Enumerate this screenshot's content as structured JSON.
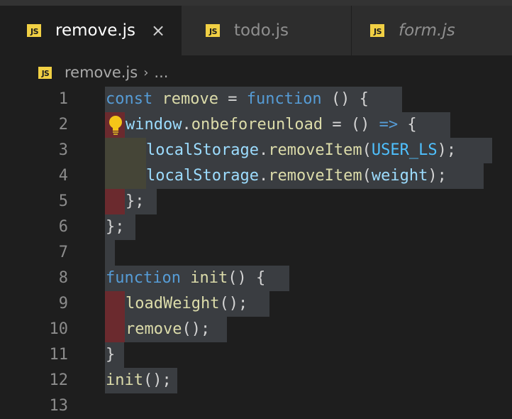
{
  "tabs": [
    {
      "label": "remove.js",
      "badge": "JS",
      "active": true,
      "italic": false,
      "close": "×"
    },
    {
      "label": "todo.js",
      "badge": "JS",
      "active": false,
      "italic": false
    },
    {
      "label": "form.js",
      "badge": "JS",
      "active": false,
      "italic": true
    }
  ],
  "breadcrumb": {
    "badge": "JS",
    "file": "remove.js",
    "separator": "›",
    "more": "..."
  },
  "colors": {
    "keyword": "#569cd6",
    "variable": "#9cdcfe",
    "function": "#dcdcaa",
    "constant": "#4fc1ff",
    "selection": "#3a3d41",
    "js_badge": "#f1d044"
  },
  "gutter": [
    "1",
    "2",
    "3",
    "4",
    "5",
    "6",
    "7",
    "8",
    "9",
    "10",
    "11",
    "12",
    "13"
  ],
  "lines": {
    "l1": {
      "kw": "const",
      "name": "remove",
      "eq": "=",
      "kw2": "function",
      "rest": "() {"
    },
    "l2": {
      "obj": "window",
      "dot": ".",
      "prop": "onbeforeunload",
      "eq": "=",
      "rest": "()",
      "arrow": "=>",
      "brace": "{"
    },
    "l3": {
      "obj": "localStorage",
      "dot": ".",
      "method": "removeItem",
      "open": "(",
      "arg": "USER_LS",
      "close": ");"
    },
    "l4": {
      "obj": "localStorage",
      "dot": ".",
      "method": "removeItem",
      "open": "(",
      "arg": "weight",
      "close": ");"
    },
    "l5": {
      "text": "};"
    },
    "l6": {
      "text": "};"
    },
    "l8": {
      "kw": "function",
      "name": "init",
      "rest": "() {"
    },
    "l9": {
      "name": "loadWeight",
      "rest": "();"
    },
    "l10": {
      "name": "remove",
      "rest": "();"
    },
    "l11": {
      "text": "}"
    },
    "l12": {
      "name": "init",
      "rest": "();"
    }
  },
  "whitespace_dot": "·",
  "lightbulb_icon": "lightbulb-icon"
}
